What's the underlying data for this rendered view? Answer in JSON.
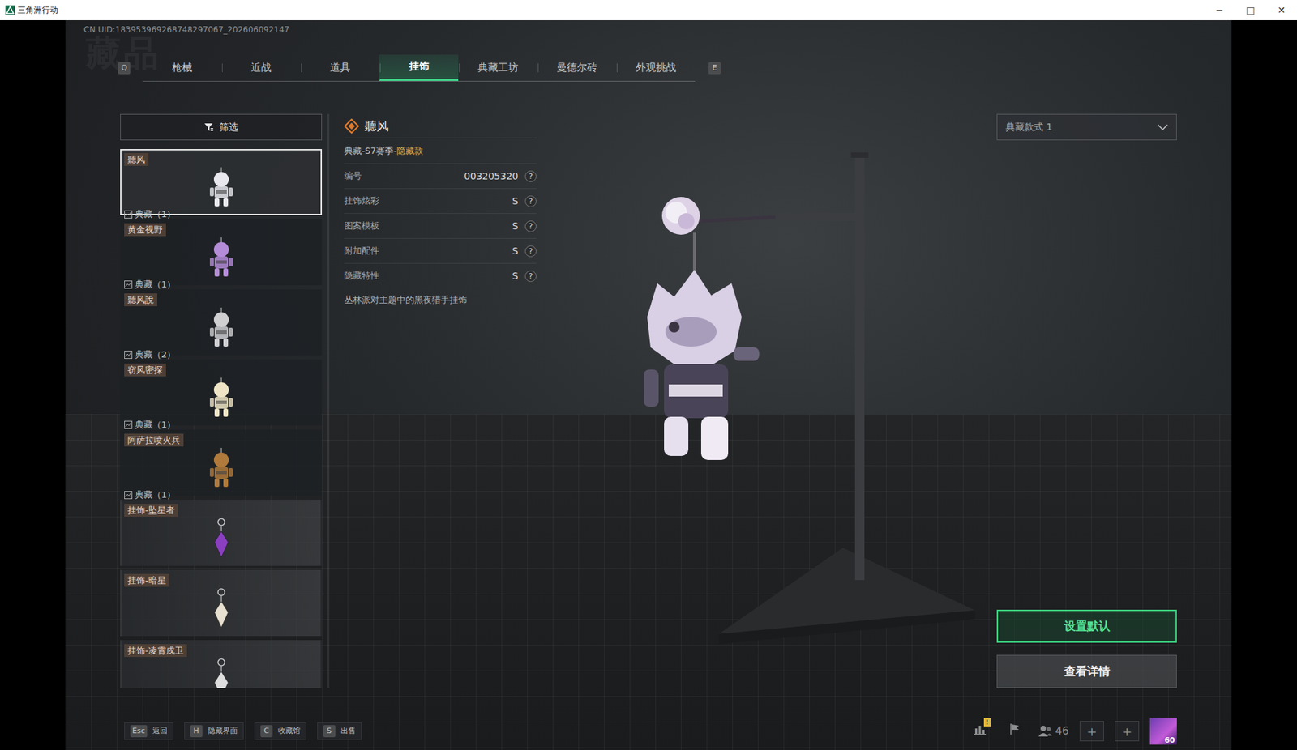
{
  "window": {
    "title": "三角洲行动",
    "controls": [
      "─",
      "□",
      "✕"
    ]
  },
  "uid": "CN UID:183953969268748297067_202606092147",
  "watermark": "藏品",
  "tab_keys": {
    "prev": "Q",
    "next": "E"
  },
  "tabs": [
    {
      "label": "枪械",
      "selected": false
    },
    {
      "label": "近战",
      "selected": false
    },
    {
      "label": "道具",
      "selected": false
    },
    {
      "label": "挂饰",
      "selected": true
    },
    {
      "label": "典藏工坊",
      "selected": false
    },
    {
      "label": "曼德尔砖",
      "selected": false
    },
    {
      "label": "外观挑战",
      "selected": false
    }
  ],
  "filter": {
    "label": "筛选"
  },
  "items": [
    {
      "name": "聽风",
      "tag": "典藏（1）",
      "kind": "collection",
      "selected": true,
      "color": "#e8e8ee"
    },
    {
      "name": "黄金视野",
      "tag": "典藏（1）",
      "kind": "collection",
      "selected": false,
      "color": "#b48cd8"
    },
    {
      "name": "聽风說",
      "tag": "典藏（2）",
      "kind": "collection",
      "selected": false,
      "color": "#cfcfd2"
    },
    {
      "name": "窃风密探",
      "tag": "典藏（1）",
      "kind": "collection",
      "selected": false,
      "color": "#efe5c6"
    },
    {
      "name": "阿萨拉喷火兵",
      "tag": "典藏（1）",
      "kind": "collection",
      "selected": false,
      "color": "#b07a3c"
    },
    {
      "name": "挂饰-坠星者",
      "kind": "plain",
      "selected": false,
      "color": "#8a3fc0"
    },
    {
      "name": "挂饰-暗星",
      "kind": "plain",
      "selected": false,
      "color": "#e8e0d0"
    },
    {
      "name": "挂饰-凌霄戍卫",
      "kind": "plain",
      "selected": false,
      "color": "#dedede"
    }
  ],
  "detail": {
    "title": "聽风",
    "subtitle": "典藏-S7赛季-",
    "subtitle_highlight": "隐藏款",
    "rows": [
      {
        "label": "编号",
        "value": "003205320",
        "help": "?"
      },
      {
        "label": "挂饰炫彩",
        "value": "S",
        "help": "?"
      },
      {
        "label": "图案模板",
        "value": "S",
        "help": "?"
      },
      {
        "label": "附加配件",
        "value": "S",
        "help": "?"
      },
      {
        "label": "隐藏特性",
        "value": "S",
        "help": "?"
      }
    ],
    "description": "丛林派对主题中的黑夜猎手挂饰"
  },
  "style_select": {
    "value": "典藏款式 1"
  },
  "buttons": [
    {
      "label": "设置默认",
      "kind": "primary"
    },
    {
      "label": "查看详情",
      "kind": "secondary"
    }
  ],
  "hints": [
    {
      "key": "Esc",
      "label": "返回"
    },
    {
      "key": "H",
      "label": "隐藏界面"
    },
    {
      "key": "C",
      "label": "收藏馆"
    },
    {
      "key": "S",
      "label": "出售"
    }
  ],
  "status": {
    "alert": "!",
    "friends": "46",
    "plus": [
      "+",
      "+"
    ],
    "level": "60"
  }
}
